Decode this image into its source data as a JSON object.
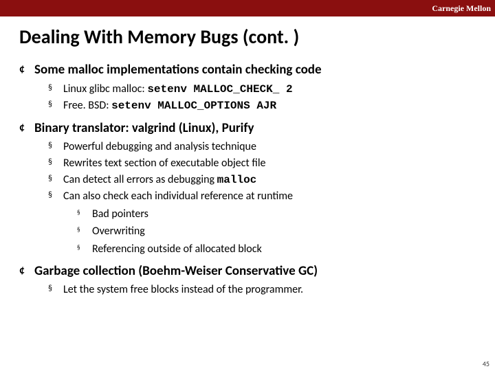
{
  "brand": "Carnegie Mellon",
  "title": "Dealing With Memory Bugs (cont. )",
  "sec1": {
    "head": "Some malloc implementations contain checking code",
    "a_pre": "Linux glibc malloc: ",
    "a_code": "setenv MALLOC_CHECK_ 2",
    "b_pre": "Free. BSD: ",
    "b_code": "setenv MALLOC_OPTIONS AJR"
  },
  "sec2": {
    "head": "Binary translator:  valgrind (Linux), Purify",
    "a": "Powerful debugging and analysis technique",
    "b": "Rewrites text section of executable object file",
    "c_pre": "Can detect all errors as debugging ",
    "c_code": "malloc",
    "d": "Can also check each individual reference at runtime",
    "d1": "Bad pointers",
    "d2": "Overwriting",
    "d3": "Referencing outside of allocated block"
  },
  "sec3": {
    "head": "Garbage collection (Boehm-Weiser Conservative GC)",
    "a": "Let the system free blocks instead of the programmer."
  },
  "pagenum": "45"
}
